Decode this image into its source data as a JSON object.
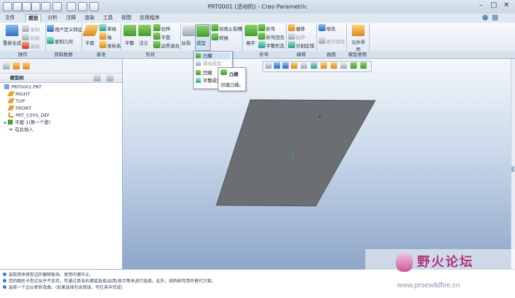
{
  "window": {
    "title": "PRT0001 (活动的) - Creo Parametric"
  },
  "tabs": [
    "文件",
    "模型",
    "分析",
    "注释",
    "渲染",
    "工具",
    "视图",
    "应用程序"
  ],
  "active_tab": "模型",
  "ribbon": {
    "regen": "重新生成",
    "copy": "复制",
    "paste": "粘贴",
    "delete": "删除",
    "udf": "用户定义特征",
    "copy_geom": "复制几何",
    "plane": "平面",
    "sketch": "草绘",
    "axis": "轴",
    "point": "点",
    "csys": "坐标系",
    "flat": "平整",
    "flange": "法兰",
    "extrude": "拉伸",
    "flat2": "平面",
    "boundary_blend": "边界混合",
    "rip": "扯裂",
    "form": "成型",
    "corner_relief": "拐角止裂槽",
    "convert": "转换",
    "bend": "折弯",
    "unbend": "展平",
    "bend_back": "折弯回去",
    "flat_pattern": "平整形态",
    "offset": "偏移",
    "extend": "延伸",
    "split_area": "分割区域",
    "fill": "填充",
    "flatten_quilt": "展平面组",
    "design_interface": "元件界面",
    "groups": [
      "操作",
      "获取数据",
      "基准",
      "形状",
      "工程",
      "折弯",
      "编辑",
      "曲面",
      "模型意图"
    ]
  },
  "form_dropdown": {
    "items": [
      "凸模",
      "草绘成型",
      "凹模",
      "平整成型"
    ]
  },
  "tooltip": {
    "title": "凸模",
    "desc": "创建凸模。"
  },
  "model_tree": {
    "header": "模型树",
    "items": [
      "PRT0001.PRT",
      "RIGHT",
      "TOP",
      "FRONT",
      "PRT_CSYS_DEF",
      "平面 1(第一个壁)",
      "在此插入"
    ]
  },
  "status_messages": [
    "选取用来修剪边的偏移板块。使用中键中止。",
    "您的图形卡型式似乎不支持，可通过单击右键或选择/启用/显示等来进行选择。此外，结构树可用作替代方案。",
    "选择一个边以使其弯曲。(如果选择包含错误，可在其中完成)"
  ],
  "watermark": {
    "cn": "野火论坛",
    "url": "www.proewildfire.cn"
  }
}
